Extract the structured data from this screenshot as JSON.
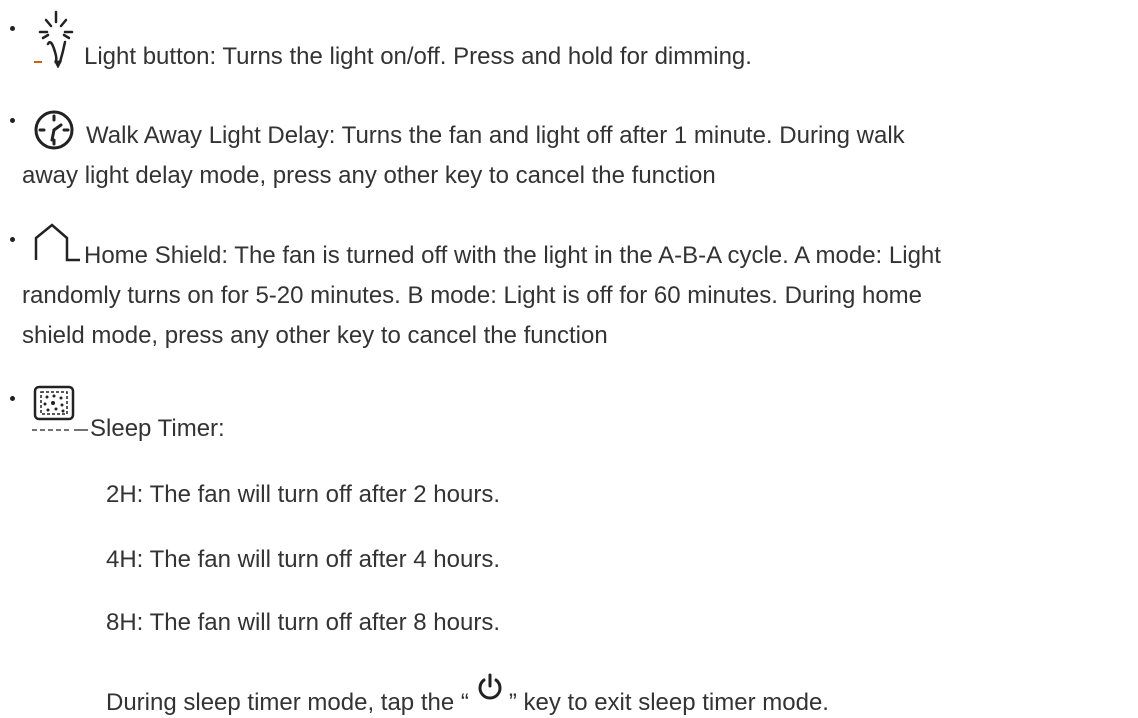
{
  "items": [
    {
      "icon": "light-bulb-icon",
      "lines": [
        "Light button: Turns the light on/off. Press and hold for dimming."
      ]
    },
    {
      "icon": "clock-icon",
      "lines": [
        "Walk Away Light Delay: Turns the fan and light off after 1 minute. During walk",
        "away light delay mode, press any other key to cancel the function"
      ]
    },
    {
      "icon": "house-icon",
      "lines": [
        "Home Shield: The fan is turned off with the light in the A-B-A cycle. A mode: Light",
        "randomly turns on for 5-20 minutes. B mode: Light is off for 60 minutes. During home",
        "shield mode, press any other key to cancel the function"
      ]
    },
    {
      "icon": "sleep-timer-icon",
      "lines": [
        "Sleep Timer:"
      ]
    }
  ],
  "sleep_timer": {
    "options": [
      "2H: The fan will turn off after 2 hours.",
      "4H: The fan will turn off after 4 hours.",
      "8H: The fan will turn off after 8 hours."
    ],
    "note_before": "During sleep timer mode, tap the “",
    "note_icon": "power-icon",
    "note_after": "” key to exit sleep timer mode."
  }
}
